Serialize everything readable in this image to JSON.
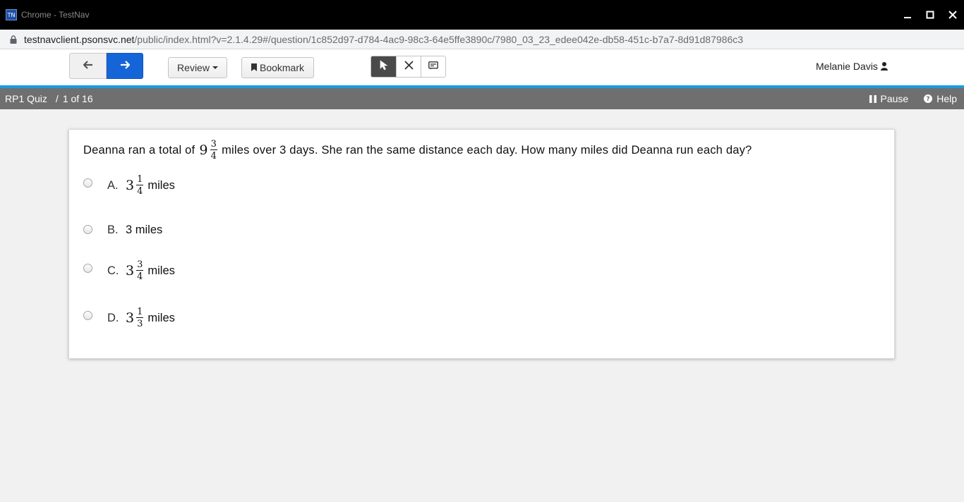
{
  "window": {
    "logo_text": "TN",
    "title": "Chrome - TestNav"
  },
  "address": {
    "host": "testnavclient.psonsvc.net",
    "path": "/public/index.html?v=2.1.4.29#/question/1c852d97-d784-4ac9-98c3-64e5ffe3890c/7980_03_23_edee042e-db58-451c-b7a7-8d91d87986c3"
  },
  "toolbar": {
    "back_icon": "arrow-left-icon",
    "next_icon": "arrow-right-icon",
    "review_label": "Review",
    "bookmark_label": "Bookmark",
    "tools": [
      "pointer-icon",
      "eliminator-x-icon",
      "notepad-icon"
    ],
    "user_name": "Melanie Davis"
  },
  "status": {
    "quiz_name": "RP1 Quiz",
    "separator": "/",
    "progress": "1 of 16",
    "pause_label": "Pause",
    "help_label": "Help"
  },
  "question": {
    "prefix": "Deanna ran a total of",
    "whole": "9",
    "numerator": "3",
    "denominator": "4",
    "suffix": "miles over 3 days. She ran the same distance each day. How many miles did Deanna run each day?"
  },
  "options": [
    {
      "letter": "A.",
      "whole": "3",
      "numerator": "1",
      "denominator": "4",
      "unit": "miles"
    },
    {
      "letter": "B.",
      "text": "3 miles"
    },
    {
      "letter": "C.",
      "whole": "3",
      "numerator": "3",
      "denominator": "4",
      "unit": "miles"
    },
    {
      "letter": "D.",
      "whole": "3",
      "numerator": "1",
      "denominator": "3",
      "unit": "miles"
    }
  ],
  "colors": {
    "accent": "#1a9be0",
    "next_button": "#1565d8",
    "status_bar": "#6f6f6f"
  }
}
